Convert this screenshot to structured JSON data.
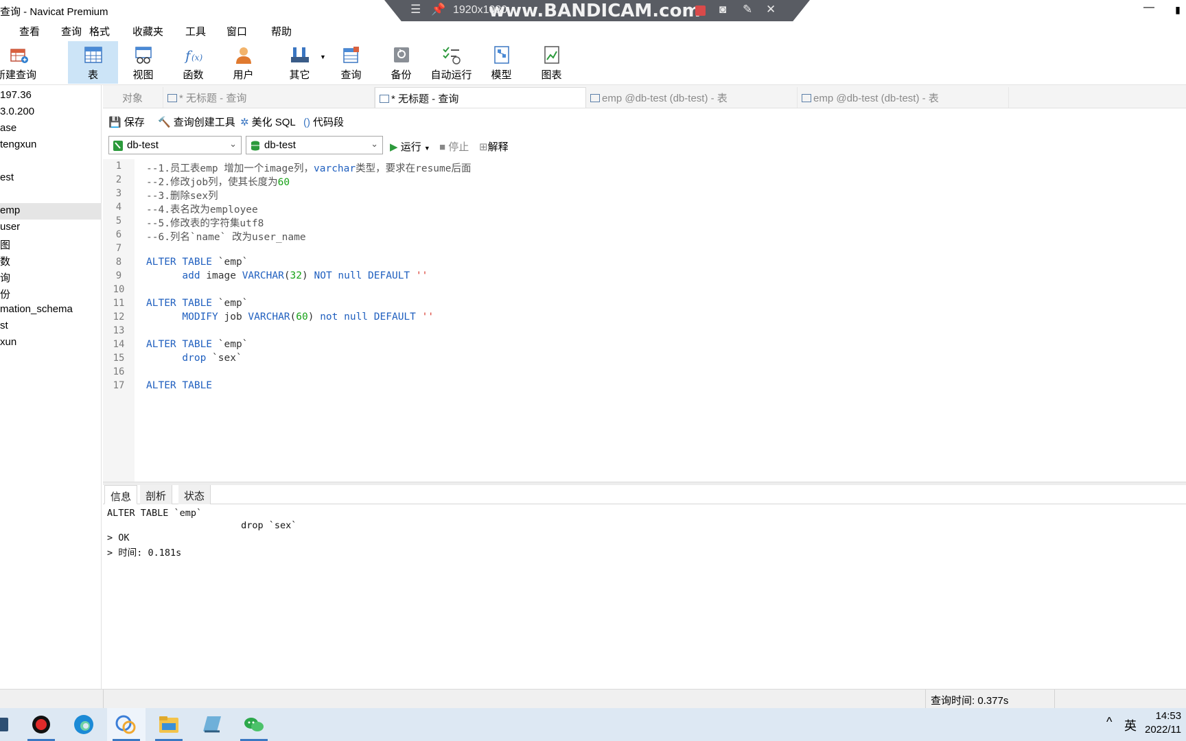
{
  "window": {
    "title": "查询 - Navicat Premium",
    "minimize_glyph": "—",
    "close_glyph": "✕"
  },
  "bandicam": {
    "resolution": "1920x1080",
    "logo": "www.BANDICAM.com"
  },
  "menu": [
    "查看",
    "查询",
    "格式",
    "收藏夹",
    "工具",
    "窗口",
    "帮助"
  ],
  "toolbar": {
    "new_query": "新建查询",
    "table": "表",
    "view": "视图",
    "function": "函数",
    "user": "用户",
    "other": "其它",
    "query": "查询",
    "backup": "备份",
    "auto_run": "自动运行",
    "model": "模型",
    "chart": "图表"
  },
  "sidebar": {
    "items": [
      "197.36",
      "3.0.200",
      "ase",
      "tengxun",
      "",
      "est",
      "",
      "emp",
      "user",
      "图",
      "数",
      "询",
      "份",
      "mation_schema",
      "st",
      "xun"
    ],
    "selected_index": 7
  },
  "tabs": {
    "objects": "对象",
    "tab1": "* 无标题 - 查询",
    "tab2": "* 无标题 - 查询",
    "tab3": "emp @db-test (db-test) - 表",
    "tab4": "emp @db-test (db-test) - 表"
  },
  "query_toolbar": {
    "save": "保存",
    "builder": "查询创建工具",
    "beautify": "美化 SQL",
    "snippet": "代码段"
  },
  "db_select": {
    "connection": "db-test",
    "database": "db-test",
    "run": "运行",
    "stop": "停止",
    "explain": "解释"
  },
  "editor": {
    "line_numbers": [
      "1",
      "2",
      "3",
      "4",
      "5",
      "6",
      "7",
      "8",
      "9",
      "10",
      "11",
      "12",
      "13",
      "14",
      "15",
      "16",
      "17"
    ]
  },
  "result": {
    "tabs": [
      "信息",
      "剖析",
      "状态"
    ],
    "lines": [
      "ALTER TABLE `emp`",
      "                        drop `sex`",
      "> OK",
      "> 时间: 0.181s"
    ]
  },
  "status": {
    "query_time": "查询时间: 0.377s"
  },
  "taskbar": {
    "tray_caret": "^",
    "ime": "英",
    "time": "14:53",
    "date": "2022/11"
  },
  "colors": {
    "keyword": "#1f5fbf",
    "number": "#17a217",
    "string": "#d9372c",
    "active_tool": "#cce4f7"
  }
}
